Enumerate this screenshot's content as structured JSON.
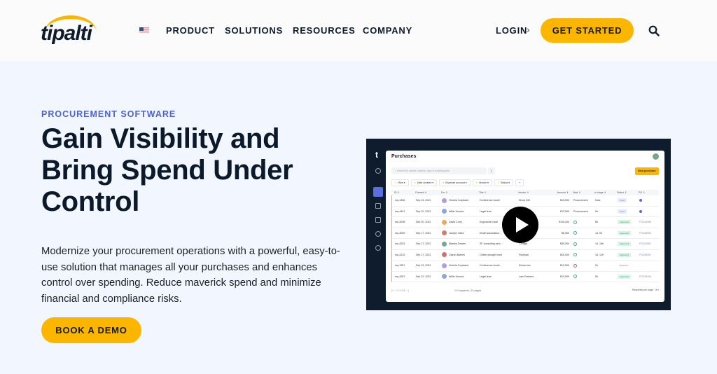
{
  "header": {
    "brand": "tipalti",
    "nav": [
      "PRODUCT",
      "SOLUTIONS",
      "RESOURCES",
      "COMPANY"
    ],
    "locale_icon": "us-flag-icon",
    "login_label": "LOGIN",
    "login_chevron": "›",
    "cta_label": "GET STARTED"
  },
  "hero": {
    "eyebrow": "PROCUREMENT SOFTWARE",
    "headline": "Gain Visibility and Bring Spend Under Control",
    "description": "Modernize your procurement operations with a powerful, easy-to-use solution that manages all your purchases and enhances control over spending. Reduce maverick spend and minimize financial and compliance risks.",
    "cta_label": "BOOK A DEMO"
  },
  "video": {
    "app": {
      "logo": "t",
      "title": "Purchases",
      "search_placeholder": "Search for names, owners, tags or anything else",
      "download_icon": "⤓",
      "new_purchase_label": "New purchase",
      "filters": [
        "View ▾",
        "Date created ▾",
        "Expense account ▾",
        "Vendor ▾",
        "Status ▾",
        "+"
      ],
      "columns": [
        "ID ⇕",
        "Created ⇕",
        "For ⇕",
        "Title ⇕",
        "Vendor ⇕",
        "Amount ⇕",
        "Next ⇕",
        "In stage ⇕",
        "Status ⇕",
        "PO ⇕"
      ],
      "rows": [
        {
          "id": "req-1456",
          "created": "Sep 23, 2022",
          "for": "Victoria Copeland",
          "avatar": "#b49ae0",
          "title": "Conference booth",
          "vendor": "Show INC",
          "amount": "$15,500",
          "next": "Procurement",
          "stage": "Now",
          "status": "Open",
          "po": ""
        },
        {
          "id": "req-4497",
          "created": "Sep 22, 2022",
          "for": "Willie Kouma",
          "avatar": "#8aa7d8",
          "title": "Legal fees",
          "vendor": "",
          "amount": "€12,500",
          "next": "Procurement",
          "stage": "5h",
          "status": "Open",
          "po": ""
        },
        {
          "id": "req-4298",
          "created": "Sep 20, 2022",
          "for": "David Curry",
          "avatar": "#e8a860",
          "title": "Ergonomic chair",
          "vendor": "",
          "amount": "¥100,000",
          "next": "ok",
          "stage": "8h",
          "status": "Approved",
          "po": "PO264956"
        },
        {
          "id": "req-4509",
          "created": "Sep 17, 2022",
          "for": "Joseph Yates",
          "avatar": "#d87a6a",
          "title": "Email automation...",
          "vendor": "",
          "amount": "$5,500",
          "next": "ok",
          "stage": "1d, 6h",
          "status": "Approved",
          "po": "PO258953"
        },
        {
          "id": "req-4233",
          "created": "Sep 17, 2022",
          "for": "Marsha Dowes",
          "avatar": "#6fae8a",
          "title": "SF consulting serv...",
          "vendor": "Configs",
          "amount": "$39,500",
          "next": "ok",
          "stage": "1d, 18h",
          "status": "Approved",
          "po": "PO254887"
        },
        {
          "id": "req-4132",
          "created": "Sep 17, 2022",
          "for": "Ciaran Barnes",
          "avatar": "#d07070",
          "title": "Online escape room",
          "vendor": "Funteam",
          "amount": "$10,000",
          "next": "ok",
          "stage": "1d, 12h",
          "status": "Approved",
          "po": "PO255951"
        },
        {
          "id": "req-1357",
          "created": "Sep 23, 2022",
          "for": "Victoria Copeland",
          "avatar": "#b49ae0",
          "title": "Conference booth",
          "vendor": "Events Inc",
          "amount": "$13,500",
          "next": "no",
          "stage": "2h",
          "status": "Rejected",
          "po": "-"
        },
        {
          "id": "req-4307",
          "created": "Sep 22, 2022",
          "for": "Willie Kouma",
          "avatar": "#8aa7d8",
          "title": "Legal fees",
          "vendor": "Law Partners",
          "amount": "€10,500",
          "next": "ok",
          "stage": "5h",
          "status": "Approved",
          "po": "PO255408"
        }
      ],
      "pager": "|‹  ‹   1  2  3  4  5   ›  ›|",
      "pager_info": "114 requests  |  24 pages",
      "rows_per_page_label": "Requests per page",
      "rows_per_page_value": "8 ▾"
    }
  }
}
